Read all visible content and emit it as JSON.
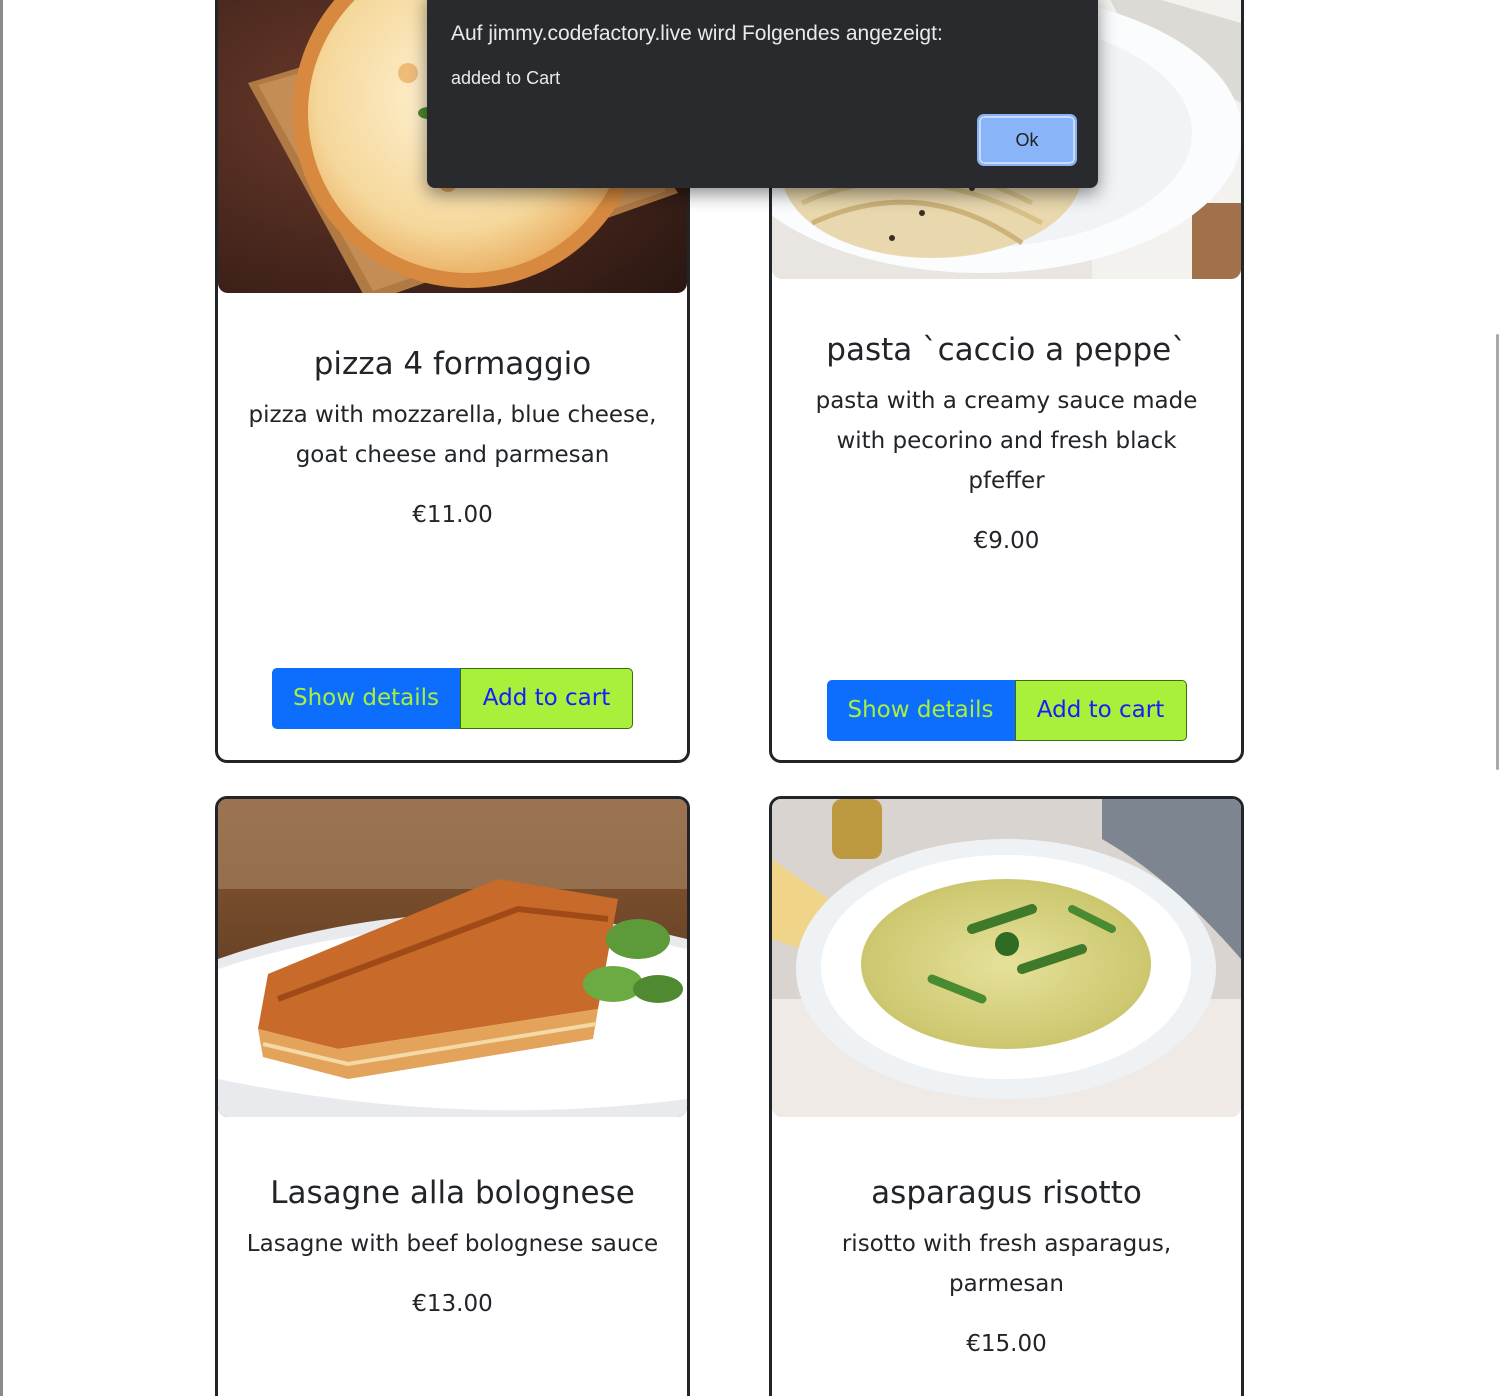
{
  "dialog": {
    "title": "Auf jimmy.codefactory.live wird Folgendes angezeigt:",
    "message": "added to Cart",
    "ok_label": "Ok"
  },
  "cards": [
    {
      "title": "pizza 4 formaggio",
      "description": "pizza with mozzarella, blue cheese, goat cheese and parmesan",
      "price": "€11.00",
      "details_label": "Show details",
      "cart_label": "Add to cart",
      "image": "pizza-photo"
    },
    {
      "title": "pasta `caccio a peppe`",
      "description": "pasta with a creamy sauce made with pecorino and fresh black pfeffer",
      "price": "€9.00",
      "details_label": "Show details",
      "cart_label": "Add to cart",
      "image": "pasta-photo"
    },
    {
      "title": "Lasagne alla bolognese",
      "description": "Lasagne with beef bolognese sauce",
      "price": "€13.00",
      "image": "lasagne-photo"
    },
    {
      "title": "asparagus risotto",
      "description": "risotto with fresh asparagus, parmesan",
      "price": "€15.00",
      "image": "risotto-photo"
    }
  ],
  "colors": {
    "details_button": "#0d6efd",
    "details_text": "#a8f03a",
    "cart_button": "#a8f03a",
    "cart_text": "#1a1aff",
    "dialog_bg": "#292a2d",
    "ok_button": "#8ab4f8"
  }
}
